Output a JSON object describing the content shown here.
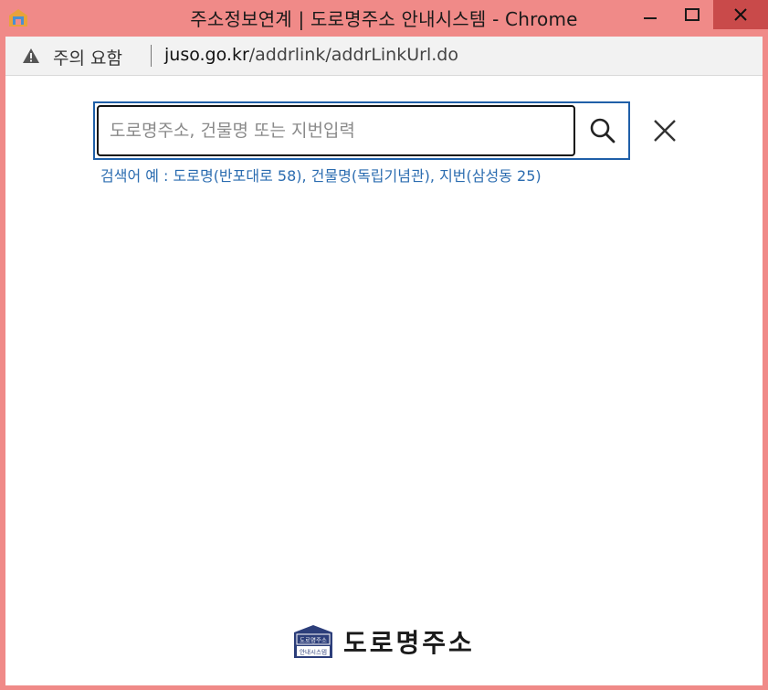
{
  "window": {
    "title": "주소정보연계 | 도로명주소 안내시스템 - Chrome",
    "colors": {
      "frame": "#f08a88",
      "close": "#c94a4a"
    }
  },
  "addressbar": {
    "security_label": "주의 요함",
    "url_host": "juso.go.kr",
    "url_path": "/addrlink/addrLinkUrl.do",
    "warning_icon": "warning-triangle-icon"
  },
  "search": {
    "placeholder": "도로명주소, 건물명 또는 지번입력",
    "value": "",
    "example": "검색어 예 : 도로명(반포대로 58), 건물명(독립기념관), 지번(삼성동 25)",
    "accent": "#1f5fa8",
    "example_color": "#2b6cb0"
  },
  "logo": {
    "badge_top": "도로명주소",
    "badge_bottom": "안내시스템",
    "text": "도로명주소"
  }
}
